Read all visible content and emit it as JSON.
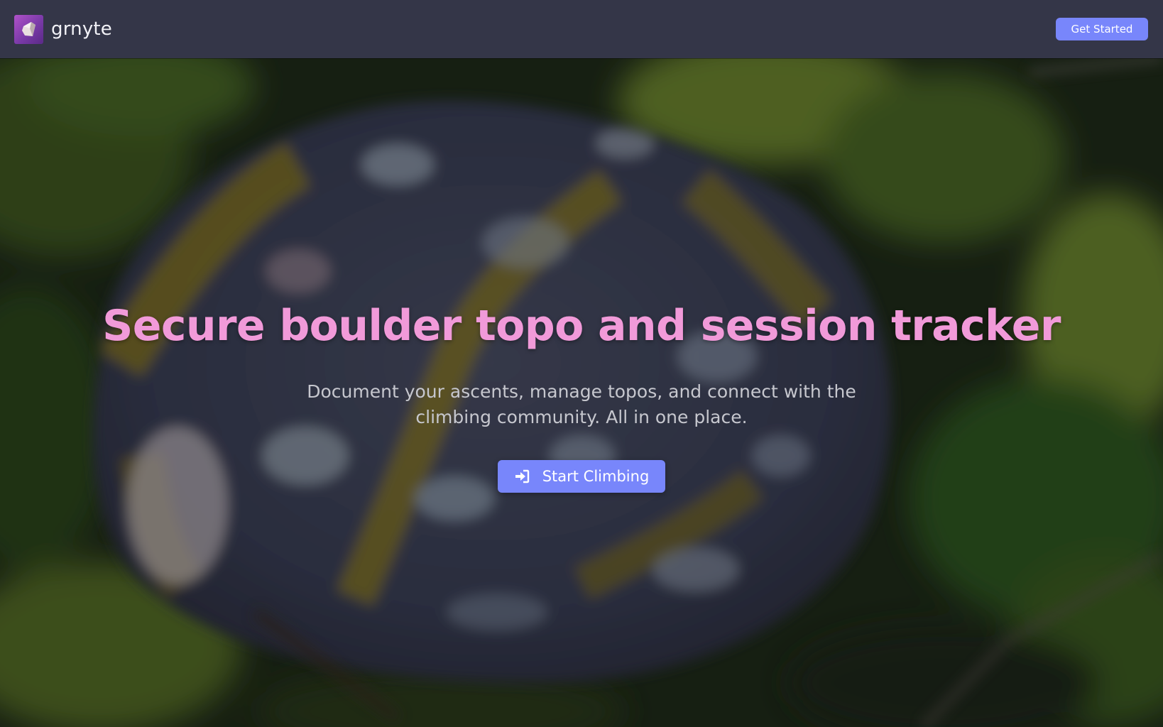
{
  "header": {
    "brand_name": "grnyte",
    "logo_icon": "boulder-icon",
    "get_started_label": "Get Started"
  },
  "hero": {
    "headline": "Secure boulder topo and session tracker",
    "subtitle": "Document your ascents, manage topos, and connect with the climbing community. All in one place.",
    "cta_label": "Start Climbing",
    "cta_icon": "sign-in-icon"
  },
  "colors": {
    "header_bg": "#343648",
    "accent_button": "#7886fb",
    "headline": "#f19ad9",
    "logo_purple": "#9a48bd"
  }
}
